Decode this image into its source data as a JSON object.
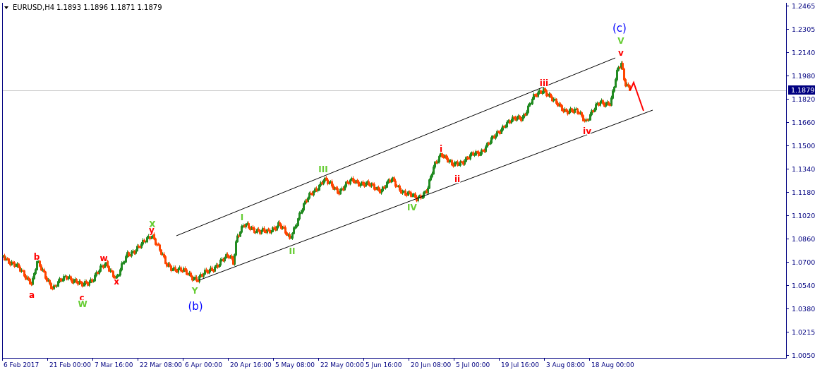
{
  "header": {
    "symbol": "EURUSD,H4",
    "ohlc": "1.1893 1.1896 1.1871 1.1879"
  },
  "price_axis": {
    "labels": [
      "1.2465",
      "1.2305",
      "1.2140",
      "1.1980",
      "1.1820",
      "1.1660",
      "1.1500",
      "1.1340",
      "1.1180",
      "1.1020",
      "1.0860",
      "1.0700",
      "1.0540",
      "1.0380",
      "1.0215",
      "1.0050"
    ],
    "current_price": "1.1879"
  },
  "time_axis": {
    "labels": [
      "6 Feb 2017",
      "21 Feb 00:00",
      "7 Mar 16:00",
      "22 Mar 08:00",
      "6 Apr 00:00",
      "20 Apr 16:00",
      "5 May 08:00",
      "22 May 00:00",
      "5 Jun 16:00",
      "20 Jun 08:00",
      "5 Jul 00:00",
      "19 Jul 16:00",
      "3 Aug 08:00",
      "18 Aug 00:00"
    ]
  },
  "wave_labels": [
    {
      "text": "a",
      "color": "#ff0000"
    },
    {
      "text": "b",
      "color": "#ff0000"
    },
    {
      "text": "c",
      "color": "#ff0000"
    },
    {
      "text": "W",
      "color": "#66cc33"
    },
    {
      "text": "w",
      "color": "#ff0000"
    },
    {
      "text": "x",
      "color": "#ff0000"
    },
    {
      "text": "X",
      "color": "#66cc33"
    },
    {
      "text": "y",
      "color": "#ff0000"
    },
    {
      "text": "Y",
      "color": "#66cc33"
    },
    {
      "text": "(b)",
      "color": "#0000ff"
    },
    {
      "text": "I",
      "color": "#66cc33"
    },
    {
      "text": "II",
      "color": "#66cc33"
    },
    {
      "text": "III",
      "color": "#66cc33"
    },
    {
      "text": "IV",
      "color": "#66cc33"
    },
    {
      "text": "i",
      "color": "#ff0000"
    },
    {
      "text": "ii",
      "color": "#ff0000"
    },
    {
      "text": "iii",
      "color": "#ff0000"
    },
    {
      "text": "iv",
      "color": "#ff0000"
    },
    {
      "text": "(c)",
      "color": "#0000ff"
    },
    {
      "text": "V",
      "color": "#66cc33"
    },
    {
      "text": "v",
      "color": "#ff0000"
    }
  ]
}
